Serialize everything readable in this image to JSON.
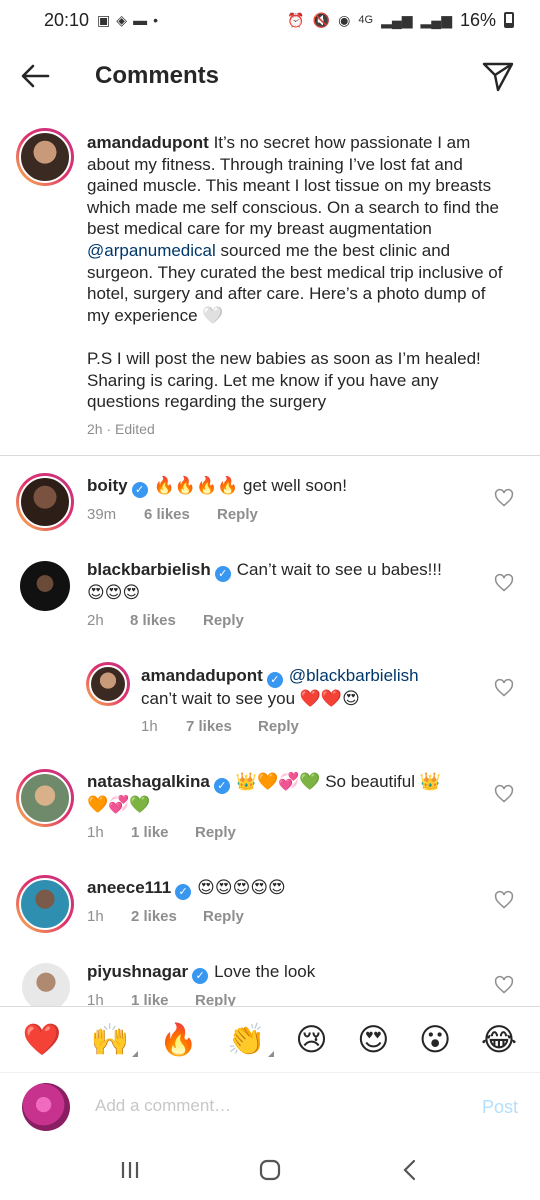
{
  "status_bar": {
    "time": "20:10",
    "network": "4G",
    "battery": "16%"
  },
  "header": {
    "title": "Comments"
  },
  "caption": {
    "username": "amandadupont",
    "text_1": " It’s no secret how passionate I am about my fitness. Through training I’ve lost fat and gained muscle. This meant I lost tissue on my breasts which made me self conscious. On a search to find the best medical care for my breast augmentation ",
    "mention": "@arpanumedical",
    "text_2": " sourced me the best clinic and surgeon. They curated the best medical trip inclusive of hotel, surgery and after care. Here’s a photo dump of my experience 🤍",
    "text_3": "P.S I will post the new babies as soon as I’m healed! Sharing is caring. Let me know if you have any questions regarding the surgery",
    "time": "2h",
    "edited": "Edited"
  },
  "comments": [
    {
      "username": "boity",
      "text": "🔥🔥🔥🔥 get well soon!",
      "time": "39m",
      "likes": "6 likes",
      "reply": "Reply"
    },
    {
      "username": "blackbarbielish",
      "text": "Can’t wait to see u babes!!!",
      "text_2": "😍😍😍",
      "time": "2h",
      "likes": "8 likes",
      "reply": "Reply"
    },
    {
      "username": "amandadupont",
      "mention": "@blackbarbielish",
      "text": "can’t wait to see you ❤️❤️😍",
      "time": "1h",
      "likes": "7 likes",
      "reply": "Reply"
    },
    {
      "username": "natashagalkina",
      "text": "👑🧡💞💚 So beautiful 👑",
      "text_2": "🧡💞💚",
      "time": "1h",
      "likes": "1 like",
      "reply": "Reply"
    },
    {
      "username": "aneece111",
      "text": "😍😍😍😍😍",
      "time": "1h",
      "likes": "2 likes",
      "reply": "Reply"
    },
    {
      "username": "piyushnagar",
      "text": "Love the look",
      "time": "1h",
      "likes": "1 like",
      "reply": "Reply"
    }
  ],
  "quick_reactions": [
    "❤️",
    "🙌",
    "🔥",
    "👏",
    "😢",
    "😍",
    "😮",
    "😂"
  ],
  "add_comment": {
    "placeholder": "Add a comment…",
    "post_label": "Post"
  },
  "colors": {
    "accent_blue": "#3897f0",
    "post_disabled": "#b2dffc",
    "mention": "#00376b",
    "meta_gray": "#8e8e8e"
  }
}
